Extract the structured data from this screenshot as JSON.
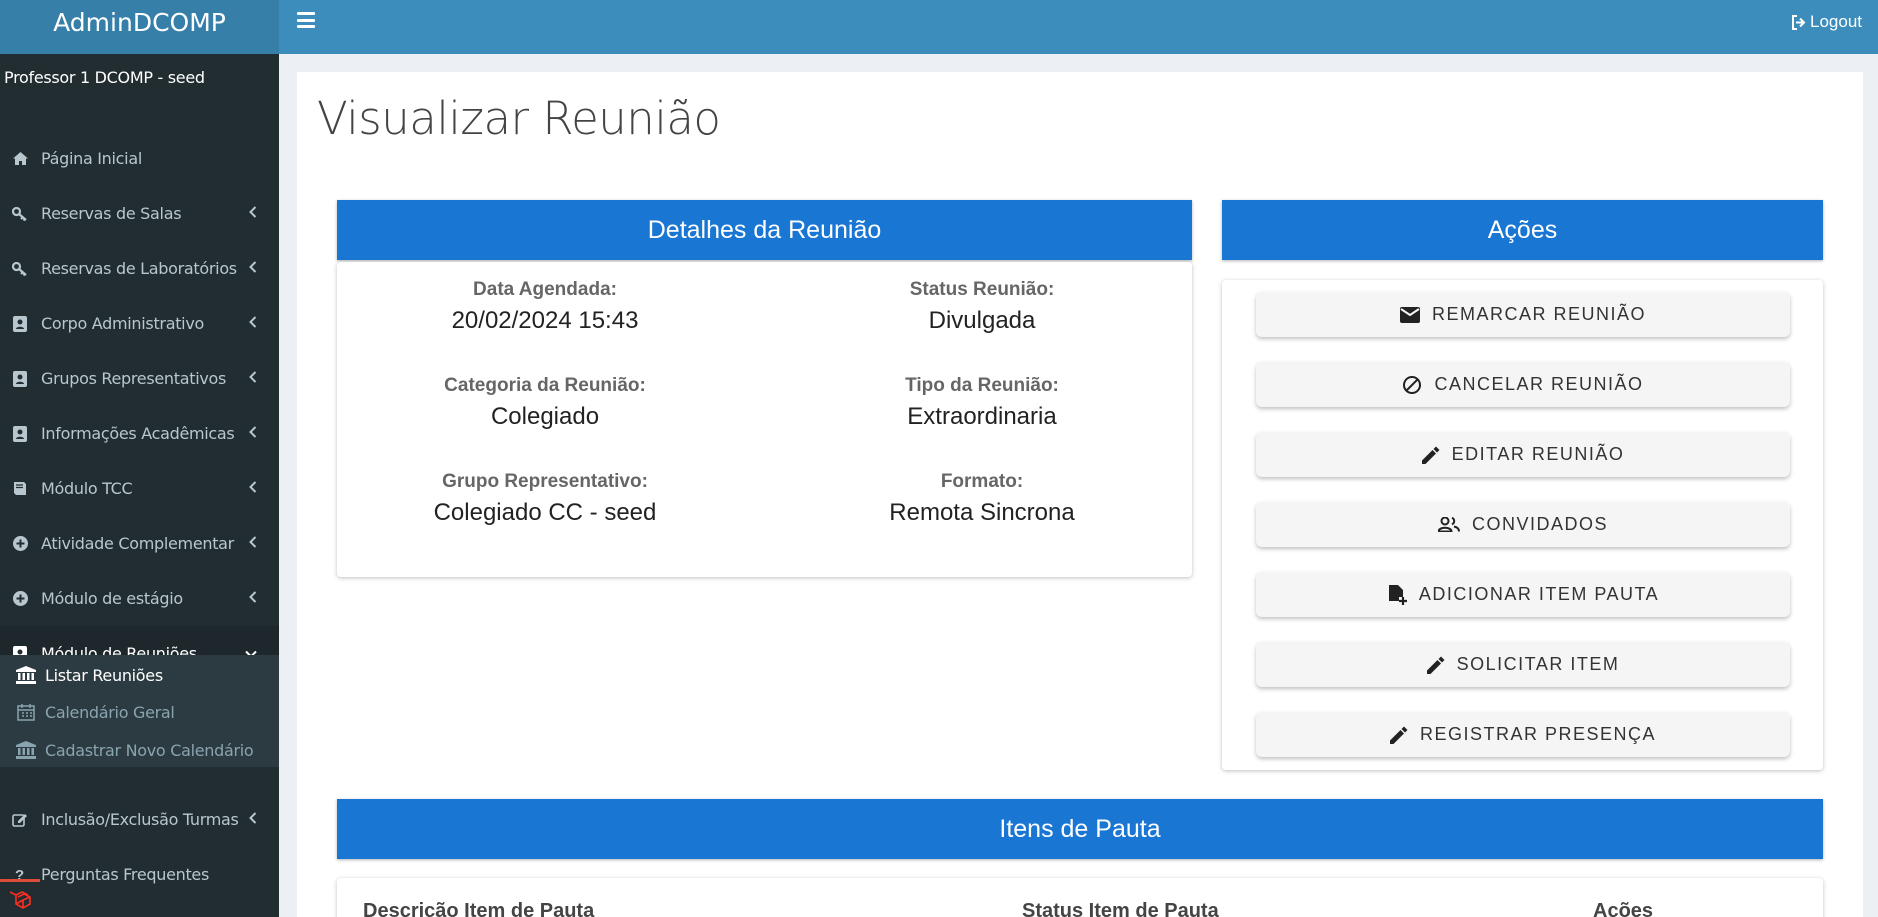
{
  "app": {
    "brand": "AdminDCOMP",
    "logout_label": "Logout"
  },
  "sidebar": {
    "user": "Professor 1 DCOMP - seed",
    "items": [
      {
        "label": "Página Inicial",
        "icon": "home-icon"
      },
      {
        "label": "Reservas de Salas",
        "icon": "key-icon"
      },
      {
        "label": "Reservas de Laboratórios",
        "icon": "key-icon"
      },
      {
        "label": "Corpo Administrativo",
        "icon": "contact-card-icon"
      },
      {
        "label": "Grupos Representativos",
        "icon": "contact-card-icon"
      },
      {
        "label": "Informações Acadêmicas",
        "icon": "contact-card-icon"
      },
      {
        "label": "Módulo TCC",
        "icon": "book-icon"
      },
      {
        "label": "Atividade Complementar",
        "icon": "plus-circle-icon"
      },
      {
        "label": "Módulo de estágio",
        "icon": "plus-circle-icon"
      },
      {
        "label": "Módulo de Reuniões",
        "icon": "contact-card-icon"
      },
      {
        "label": "Inclusão/Exclusão Turmas",
        "icon": "edit-icon"
      },
      {
        "label": "Perguntas Frequentes",
        "icon": "question-icon"
      }
    ],
    "submenu": [
      {
        "label": "Listar Reuniões",
        "icon": "institution-icon"
      },
      {
        "label": "Calendário Geral",
        "icon": "calendar-icon"
      },
      {
        "label": "Cadastrar Novo Calendário",
        "icon": "institution-icon"
      }
    ]
  },
  "page": {
    "title": "Visualizar Reunião"
  },
  "details": {
    "header": "Detalhes da Reunião",
    "fields": [
      {
        "label": "Data Agendada:",
        "value": "20/02/2024 15:43"
      },
      {
        "label": "Status Reunião:",
        "value": "Divulgada"
      },
      {
        "label": "Categoria da Reunião:",
        "value": "Colegiado"
      },
      {
        "label": "Tipo da Reunião:",
        "value": "Extraordinaria"
      },
      {
        "label": "Grupo Representativo:",
        "value": "Colegiado CC - seed"
      },
      {
        "label": "Formato:",
        "value": "Remota Sincrona"
      }
    ]
  },
  "actions": {
    "header": "Ações",
    "buttons": [
      {
        "label": "REMARCAR REUNIÃO",
        "icon": "mail-icon"
      },
      {
        "label": "CANCELAR REUNIÃO",
        "icon": "block-icon"
      },
      {
        "label": "EDITAR REUNIÃO",
        "icon": "pencil-icon"
      },
      {
        "label": "CONVIDADOS",
        "icon": "people-icon"
      },
      {
        "label": "ADICIONAR ITEM PAUTA",
        "icon": "note-add-icon"
      },
      {
        "label": "SOLICITAR ITEM",
        "icon": "pencil-icon"
      },
      {
        "label": "REGISTRAR PRESENÇA",
        "icon": "pencil-icon"
      }
    ]
  },
  "agenda": {
    "header": "Itens de Pauta",
    "columns": [
      "Descrição Item de Pauta",
      "Status Item de Pauta",
      "Ações"
    ]
  },
  "colors": {
    "topbar": "#3c8dbc",
    "logo": "#367fa9",
    "sidebar": "#222d32",
    "panel_header": "#1976d2"
  }
}
